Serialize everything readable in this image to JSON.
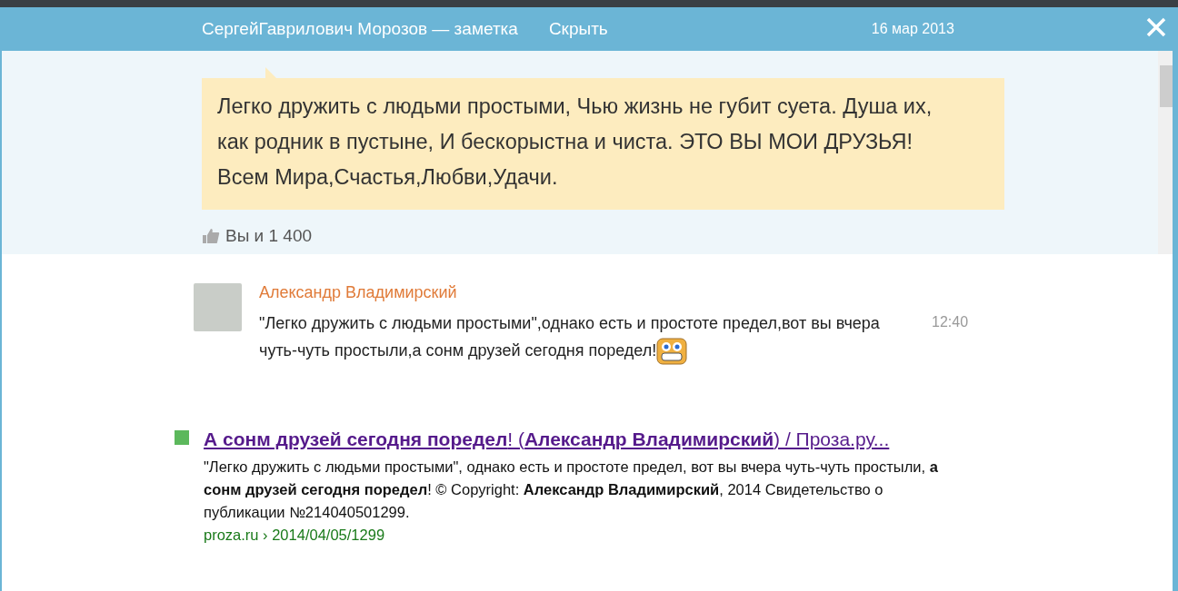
{
  "header": {
    "title": "СергейГаврилович Морозов — заметка",
    "hide_link": "Скрыть",
    "date": "16 мар 2013"
  },
  "note": {
    "text": "Легко дружить с людьми простыми, Чью жизнь не губит суета. Душа их, как родник в пустыне, И бескорыстна и чиста. ЭТО ВЫ МОИ ДРУЗЬЯ! Всем Мира,Счастья,Любви,Удачи.",
    "likes": "Вы и 1 400"
  },
  "comment": {
    "author": "Александр Владимирский",
    "text": "\"Легко дружить с людьми простыми\",однако есть и простоте предел,вот вы вчера чуть-чуть простыли,а сонм друзей сегодня поредел!",
    "time": "12:40"
  },
  "result": {
    "title": "**А сонм друзей сегодня поредел**! (**Александр Владимирский**) / Проза.ру...",
    "snippet": "\"Легко дружить с людьми простыми\", однако есть и простоте предел, вот вы вчера чуть-чуть простыли, **а сонм друзей сегодня поредел**! © Copyright: **Александр Владимирский**, 2014 Свидетельство о публикации №214040501299.",
    "url": "proza.ru › 2014/04/05/1299"
  }
}
